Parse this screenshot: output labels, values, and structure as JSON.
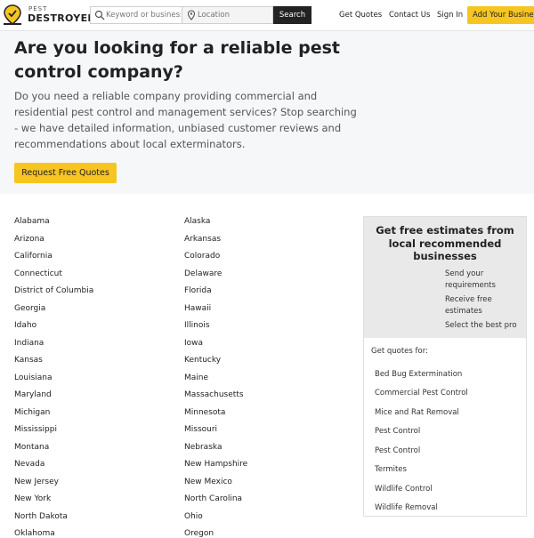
{
  "header": {
    "logo_small": "PEST",
    "logo_big": "DESTROYERS",
    "search_keyword_placeholder": "Keyword or business",
    "search_location_placeholder": "Location",
    "search_button": "Search",
    "nav": [
      "Get Quotes",
      "Contact Us",
      "Sign In"
    ],
    "add_business": "Add Your Business"
  },
  "hero": {
    "title": "Are you looking for a reliable pest control company?",
    "description": "Do you need a reliable company providing commercial and residential pest control and management services? Stop searching - we have detailed information, unbiased customer reviews and recommendations about local exterminators.",
    "cta": "Request Free Quotes"
  },
  "states_left": [
    "Alabama",
    "Arizona",
    "California",
    "Connecticut",
    "District of Columbia",
    "Georgia",
    "Idaho",
    "Indiana",
    "Kansas",
    "Louisiana",
    "Maryland",
    "Michigan",
    "Mississippi",
    "Montana",
    "Nevada",
    "New Jersey",
    "New York",
    "North Dakota",
    "Oklahoma"
  ],
  "states_right": [
    "Alaska",
    "Arkansas",
    "Colorado",
    "Delaware",
    "Florida",
    "Hawaii",
    "Illinois",
    "Iowa",
    "Kentucky",
    "Maine",
    "Massachusetts",
    "Minnesota",
    "Missouri",
    "Nebraska",
    "New Hampshire",
    "New Mexico",
    "North Carolina",
    "Ohio",
    "Oregon"
  ],
  "sidebar": {
    "title": "Get free estimates from local recommended businesses",
    "steps": [
      "Send your requirements",
      "Receive free estimates",
      "Select the best pro"
    ],
    "get_quotes_for": "Get quotes for:",
    "services": [
      "Bed Bug Extermination",
      "Commercial Pest Control",
      "Mice and Rat Removal",
      "Pest Control",
      "Pest Control",
      "Termites",
      "Wildlife Control",
      "Wildlife Removal"
    ]
  },
  "colors": {
    "accent": "#f7c521",
    "dark": "#222222",
    "hero_bg": "#f6f7f9"
  }
}
